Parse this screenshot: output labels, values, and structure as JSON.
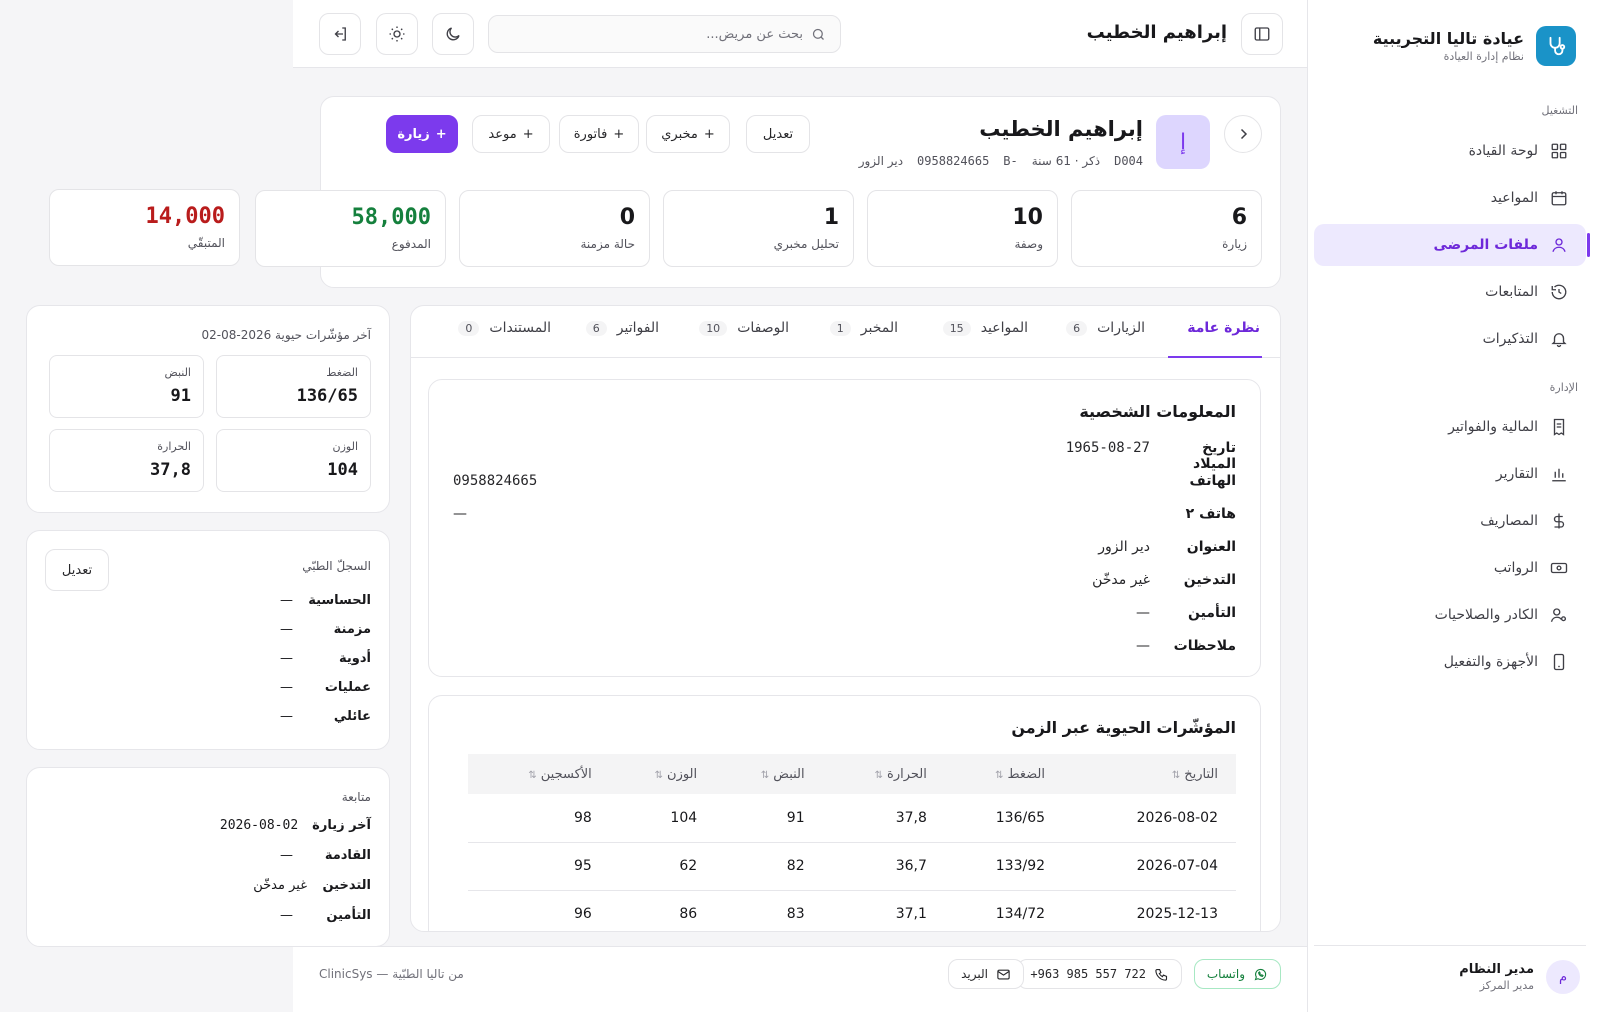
{
  "sidebar": {
    "brand_name": "عيادة تاليا التجريبية",
    "brand_sub": "نظام إدارة العيادة",
    "section_ops": "التشغيل",
    "section_admin": "الإدارة",
    "items": [
      {
        "label": "لوحة القيادة",
        "icon": "grid-icon"
      },
      {
        "label": "المواعيد",
        "icon": "calendar-icon"
      },
      {
        "label": "ملفات المرضى",
        "icon": "user-icon",
        "active": true
      },
      {
        "label": "المتابعات",
        "icon": "history-icon"
      },
      {
        "label": "التذكيرات",
        "icon": "bell-icon"
      },
      {
        "label": "المالية والفواتير",
        "icon": "receipt-icon"
      },
      {
        "label": "التقارير",
        "icon": "bar-chart-icon"
      },
      {
        "label": "المصاريف",
        "icon": "dollar-icon"
      },
      {
        "label": "الرواتب",
        "icon": "banknote-icon"
      },
      {
        "label": "الكادر والصلاحيات",
        "icon": "users-cog-icon"
      },
      {
        "label": "الأجهزة والتفعيل",
        "icon": "smartphone-icon"
      }
    ],
    "user": {
      "initial": "م",
      "name": "مدير النظام",
      "role": "مدير المركز"
    }
  },
  "header": {
    "title": "إبراهيم الخطيب",
    "search_placeholder": "بحث عن مريض..."
  },
  "patient": {
    "initial": "إ",
    "name": "إبراهيم الخطيب",
    "code": "D004",
    "gender_age": "ذكر · 61 سنة",
    "blood": "B-",
    "phone": "0958824665",
    "city": "دير الزور",
    "actions": {
      "visit": "زيارة",
      "appointment": "موعد",
      "invoice": "فاتورة",
      "lab": "مخبري",
      "edit": "تعديل"
    },
    "stats": [
      {
        "value": "6",
        "label": "زيارة"
      },
      {
        "value": "10",
        "label": "وصفة"
      },
      {
        "value": "1",
        "label": "تحليل مخبري"
      },
      {
        "value": "0",
        "label": "حالة مزمنة"
      },
      {
        "value": "58,000",
        "label": "المدفوع",
        "color": "#15803d"
      },
      {
        "value": "14,000",
        "label": "المتبقّي",
        "color": "#b91c1c"
      }
    ]
  },
  "tabs": [
    {
      "label": "نظرة عامة",
      "count": ""
    },
    {
      "label": "الزيارات",
      "count": "6"
    },
    {
      "label": "المواعيد",
      "count": "15"
    },
    {
      "label": "المخبر",
      "count": "1"
    },
    {
      "label": "الوصفات",
      "count": "10"
    },
    {
      "label": "الفواتير",
      "count": "6"
    },
    {
      "label": "المستندات",
      "count": "0"
    }
  ],
  "personal": {
    "title": "المعلومات الشخصية",
    "rows": [
      {
        "key": "تاريخ الميلاد",
        "value": "1965-08-27"
      },
      {
        "key": "الهاتف",
        "value": "0958824665"
      },
      {
        "key": "هاتف ٢",
        "value": "—"
      },
      {
        "key": "العنوان",
        "value": "دير الزور"
      },
      {
        "key": "التدخين",
        "value": "غير مدخّن"
      },
      {
        "key": "التأمين",
        "value": "—"
      },
      {
        "key": "ملاحظات",
        "value": "—"
      }
    ]
  },
  "vitals_table": {
    "title": "المؤشّرات الحيوية عبر الزمن",
    "headers": [
      "التاريخ",
      "الضغط",
      "الحرارة",
      "النبض",
      "الوزن",
      "الأكسجين"
    ],
    "rows": [
      [
        "2026-08-02",
        "136/65",
        "37,8",
        "91",
        "104",
        "98"
      ],
      [
        "2026-07-04",
        "133/92",
        "36,7",
        "82",
        "62",
        "95"
      ],
      [
        "2025-12-13",
        "134/72",
        "37,1",
        "83",
        "86",
        "96"
      ]
    ]
  },
  "latest_vitals": {
    "title": "آخر مؤشّرات حيوية 2026-08-02",
    "items": [
      {
        "label": "الضغط",
        "value": "136/65"
      },
      {
        "label": "النبض",
        "value": "91"
      },
      {
        "label": "الوزن",
        "value": "104"
      },
      {
        "label": "الحرارة",
        "value": "37,8"
      }
    ]
  },
  "history": {
    "title": "السجلّ الطبّي",
    "edit": "تعديل",
    "rows": [
      {
        "key": "الحساسية",
        "value": "—"
      },
      {
        "key": "مزمنة",
        "value": "—"
      },
      {
        "key": "أدوية",
        "value": "—"
      },
      {
        "key": "عمليات",
        "value": "—"
      },
      {
        "key": "عائلي",
        "value": "—"
      }
    ]
  },
  "followup": {
    "title": "متابعة",
    "rows": [
      {
        "key": "آخر زيارة",
        "value": "2026-08-02"
      },
      {
        "key": "القادمة",
        "value": "—"
      },
      {
        "key": "التدخين",
        "value": "غير مدخّن"
      },
      {
        "key": "التأمين",
        "value": "—"
      }
    ]
  },
  "footer": {
    "whatsapp": "واتساب",
    "phone": "+963 985 557 722",
    "mail": "البريد",
    "credit": "ClinicSys — من تاليا الطبّية"
  }
}
